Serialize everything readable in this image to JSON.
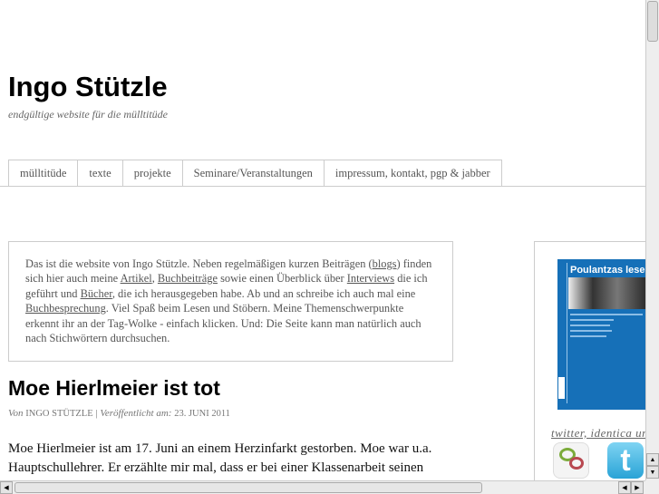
{
  "header": {
    "title": "Ingo Stützle",
    "tagline": "endgültige website für die mülltitüde"
  },
  "nav": {
    "items": [
      "mülltitüde",
      "texte",
      "projekte",
      "Seminare/Veranstaltungen",
      "impressum, kontakt, pgp & jabber"
    ]
  },
  "intro": {
    "t1": "Das ist die website von Ingo Stützle. Neben regelmäßigen kurzen Beiträgen (",
    "l1": "blogs",
    "t2": ") finden sich hier auch meine ",
    "l2": "Artikel",
    "t3": ", ",
    "l3": "Buchbeiträge",
    "t4": " sowie einen Überblick über ",
    "l4": "Interviews",
    "t5": " die ich geführt und ",
    "l5": "Bücher",
    "t6": ", die ich herausgegeben habe. Ab und an schreibe ich auch mal eine ",
    "l6": "Buchbesprechung",
    "t7": ". Viel Spaß beim Lesen und Stöbern. Meine Themenschwerpunkte erkennt ihr an der Tag-Wolke - einfach klicken. Und: Die Seite kann man natürlich auch nach Stichwörtern durchsuchen."
  },
  "post": {
    "title": "Moe Hierlmeier ist tot",
    "by_label": "Von",
    "author": "Ingo Stützle",
    "sep": "|",
    "published_label": "Veröffentlicht am:",
    "date": "23. Juni 2011",
    "body": "Moe Hierlmeier ist am 17. Juni an einem Herzinfarkt gestorben. Moe war u.a. Hauptschullehrer. Er erzählte mir mal, dass er bei einer Klassenarbeit seinen"
  },
  "sidebar": {
    "book_title": "Poulantzas lesen",
    "social_heading": "twitter, identica und",
    "icons": [
      "identica-icon",
      "twitter-icon"
    ],
    "twitter_glyph": "t"
  },
  "scrollbars": {
    "up": "▲",
    "down": "▼",
    "left": "◀",
    "right": "▶"
  }
}
